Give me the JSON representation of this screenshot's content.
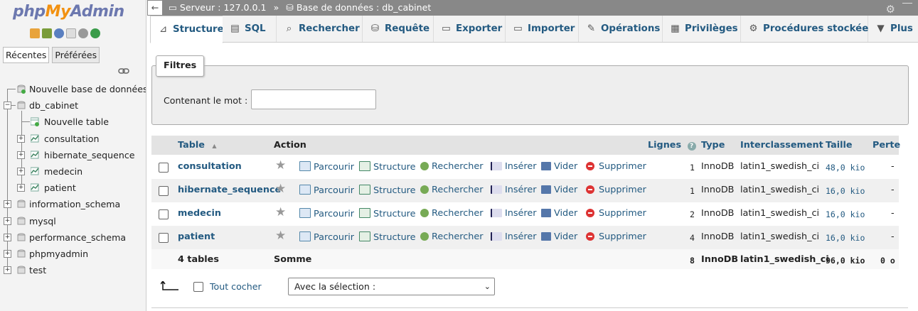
{
  "app": {
    "logo_php": "php",
    "logo_my": "My",
    "logo_admin": "Admin"
  },
  "nav_tabs": {
    "recent": "Récentes",
    "favorites": "Préférées"
  },
  "tree": {
    "new_db": "Nouvelle base de données",
    "current_db": "db_cabinet",
    "new_table": "Nouvelle table",
    "tables": [
      "consultation",
      "hibernate_sequence",
      "medecin",
      "patient"
    ],
    "other_dbs": [
      "information_schema",
      "mysql",
      "performance_schema",
      "phpmyadmin",
      "test"
    ]
  },
  "breadcrumb": {
    "server": "Serveur : 127.0.0.1",
    "sep": "»",
    "database": "Base de données : db_cabinet"
  },
  "tabs": [
    "Structure",
    "SQL",
    "Rechercher",
    "Requête",
    "Exporter",
    "Importer",
    "Opérations",
    "Privilèges",
    "Procédures stockées",
    "Plus"
  ],
  "filter": {
    "legend": "Filtres",
    "label": "Contenant le mot :",
    "value": ""
  },
  "table": {
    "headers": {
      "table": "Table",
      "sort": "▲",
      "action": "Action",
      "rows": "Lignes",
      "type": "Type",
      "collation": "Interclassement",
      "size": "Taille",
      "overhead": "Perte"
    },
    "actions": {
      "browse": "Parcourir",
      "structure": "Structure",
      "search": "Rechercher",
      "insert": "Insérer",
      "empty": "Vider",
      "drop": "Supprimer"
    },
    "rows": [
      {
        "name": "consultation",
        "rows": "1",
        "type": "InnoDB",
        "collation": "latin1_swedish_ci",
        "size": "48,0 kio",
        "overhead": "-"
      },
      {
        "name": "hibernate_sequence",
        "rows": "1",
        "type": "InnoDB",
        "collation": "latin1_swedish_ci",
        "size": "16,0 kio",
        "overhead": "-"
      },
      {
        "name": "medecin",
        "rows": "2",
        "type": "InnoDB",
        "collation": "latin1_swedish_ci",
        "size": "16,0 kio",
        "overhead": "-"
      },
      {
        "name": "patient",
        "rows": "4",
        "type": "InnoDB",
        "collation": "latin1_swedish_ci",
        "size": "16,0 kio",
        "overhead": "-"
      }
    ],
    "footer": {
      "count": "4 tables",
      "sum": "Somme",
      "rows": "8",
      "type": "InnoDB",
      "collation": "latin1_swedish_ci",
      "size": "96,0 kio",
      "overhead": "0 o"
    }
  },
  "bottom": {
    "check_all": "Tout cocher",
    "with_selected": "Avec la sélection :"
  }
}
